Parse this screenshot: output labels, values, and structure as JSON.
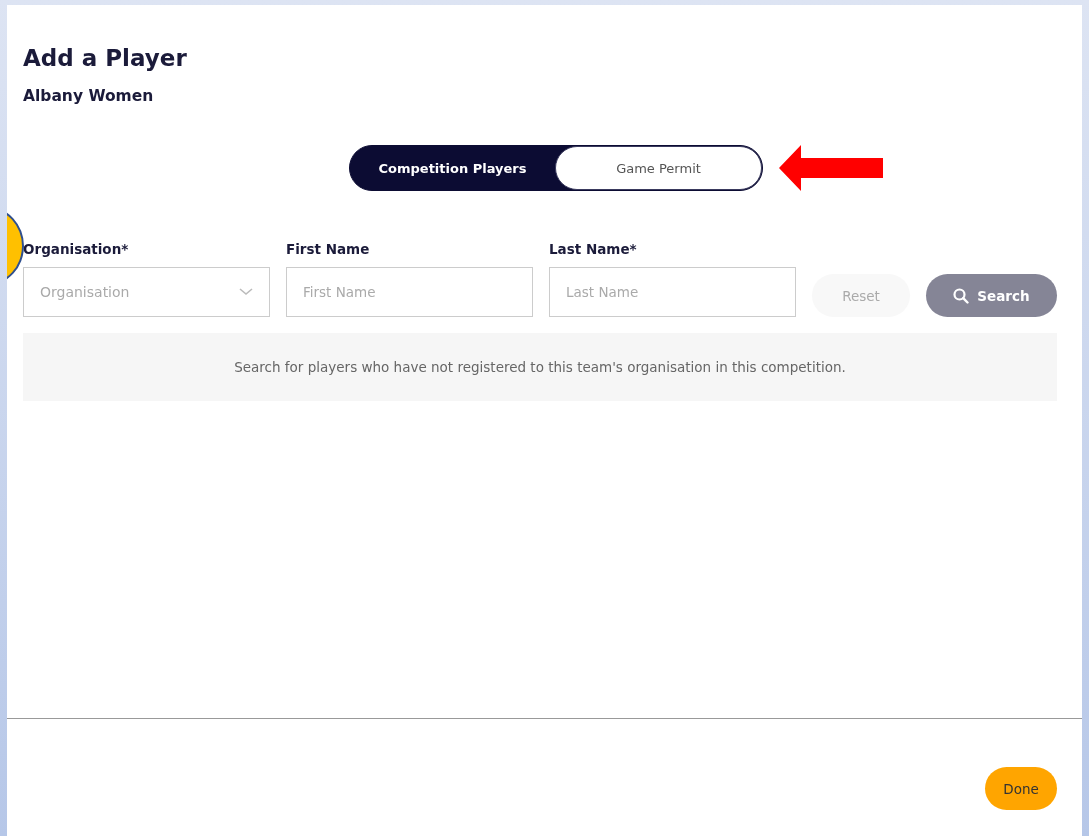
{
  "dialog": {
    "title": "Add a Player",
    "subtitle": "Albany Women"
  },
  "tabs": [
    {
      "label": "Competition Players",
      "selected": true
    },
    {
      "label": "Game Permit",
      "selected": false
    }
  ],
  "fields": [
    {
      "kind": "dropdown",
      "label": "Organisation*",
      "placeholder": "Organisation"
    },
    {
      "kind": "text",
      "label": "First Name",
      "placeholder": "First Name"
    },
    {
      "kind": "text",
      "label": "Last Name*",
      "placeholder": "Last Name"
    }
  ],
  "buttons": [
    {
      "kind": "reset",
      "label": "Reset",
      "disabled": true
    },
    {
      "kind": "search",
      "label": "Search",
      "disabled": true
    }
  ],
  "message": "Search for players who have not registered to this team's organisation in this competition.",
  "footer": {
    "done_label": "Done"
  }
}
